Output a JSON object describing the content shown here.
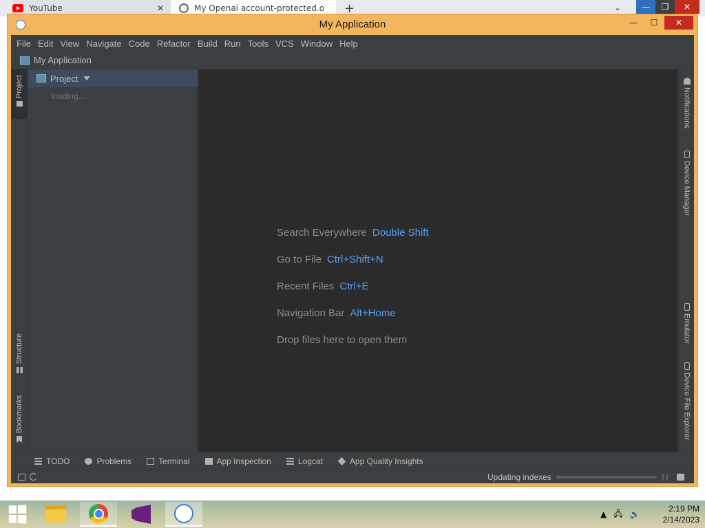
{
  "browser": {
    "tabs": [
      {
        "title": "YouTube"
      },
      {
        "title": "My Openai account-protected.o"
      }
    ],
    "new_tab": "+",
    "chevron": "⌄",
    "close_glyph": "✕"
  },
  "window": {
    "title": "My Application"
  },
  "menubar": {
    "items": [
      "File",
      "Edit",
      "View",
      "Navigate",
      "Code",
      "Refactor",
      "Build",
      "Run",
      "Tools",
      "VCS",
      "Window",
      "Help"
    ]
  },
  "navbar": {
    "breadcrumb": "My Application"
  },
  "left_toolwindows": {
    "project": "Project",
    "structure": "Structure",
    "bookmarks": "Bookmarks"
  },
  "project_panel": {
    "title": "Project",
    "loading_text": "loading..."
  },
  "editor": {
    "hints": [
      {
        "label": "Search Everywhere",
        "shortcut": "Double Shift"
      },
      {
        "label": "Go to File",
        "shortcut": "Ctrl+Shift+N"
      },
      {
        "label": "Recent Files",
        "shortcut": "Ctrl+E"
      },
      {
        "label": "Navigation Bar",
        "shortcut": "Alt+Home"
      },
      {
        "label": "Drop files here to open them",
        "shortcut": ""
      }
    ]
  },
  "right_toolwindows": {
    "notifications": "Notifications",
    "device_manager": "Device Manager",
    "emulator": "Emulator",
    "device_file_explorer": "Device File Explorer"
  },
  "bottom_tools": [
    "TODO",
    "Problems",
    "Terminal",
    "App Inspection",
    "Logcat",
    "App Quality Insights"
  ],
  "statusbar": {
    "text": "Updating indexes",
    "progress": 0.0
  },
  "taskbar": {
    "time": "2:19 PM",
    "date": "2/14/2023",
    "apps": [
      "File Explorer",
      "Google Chrome",
      "Visual Studio",
      "Android Studio"
    ]
  },
  "colors": {
    "window_frame": "#f3b55e",
    "editor_bg": "#2b2b2b",
    "shortcut_blue": "#589df6",
    "hint_gray": "#8c8c8c"
  }
}
